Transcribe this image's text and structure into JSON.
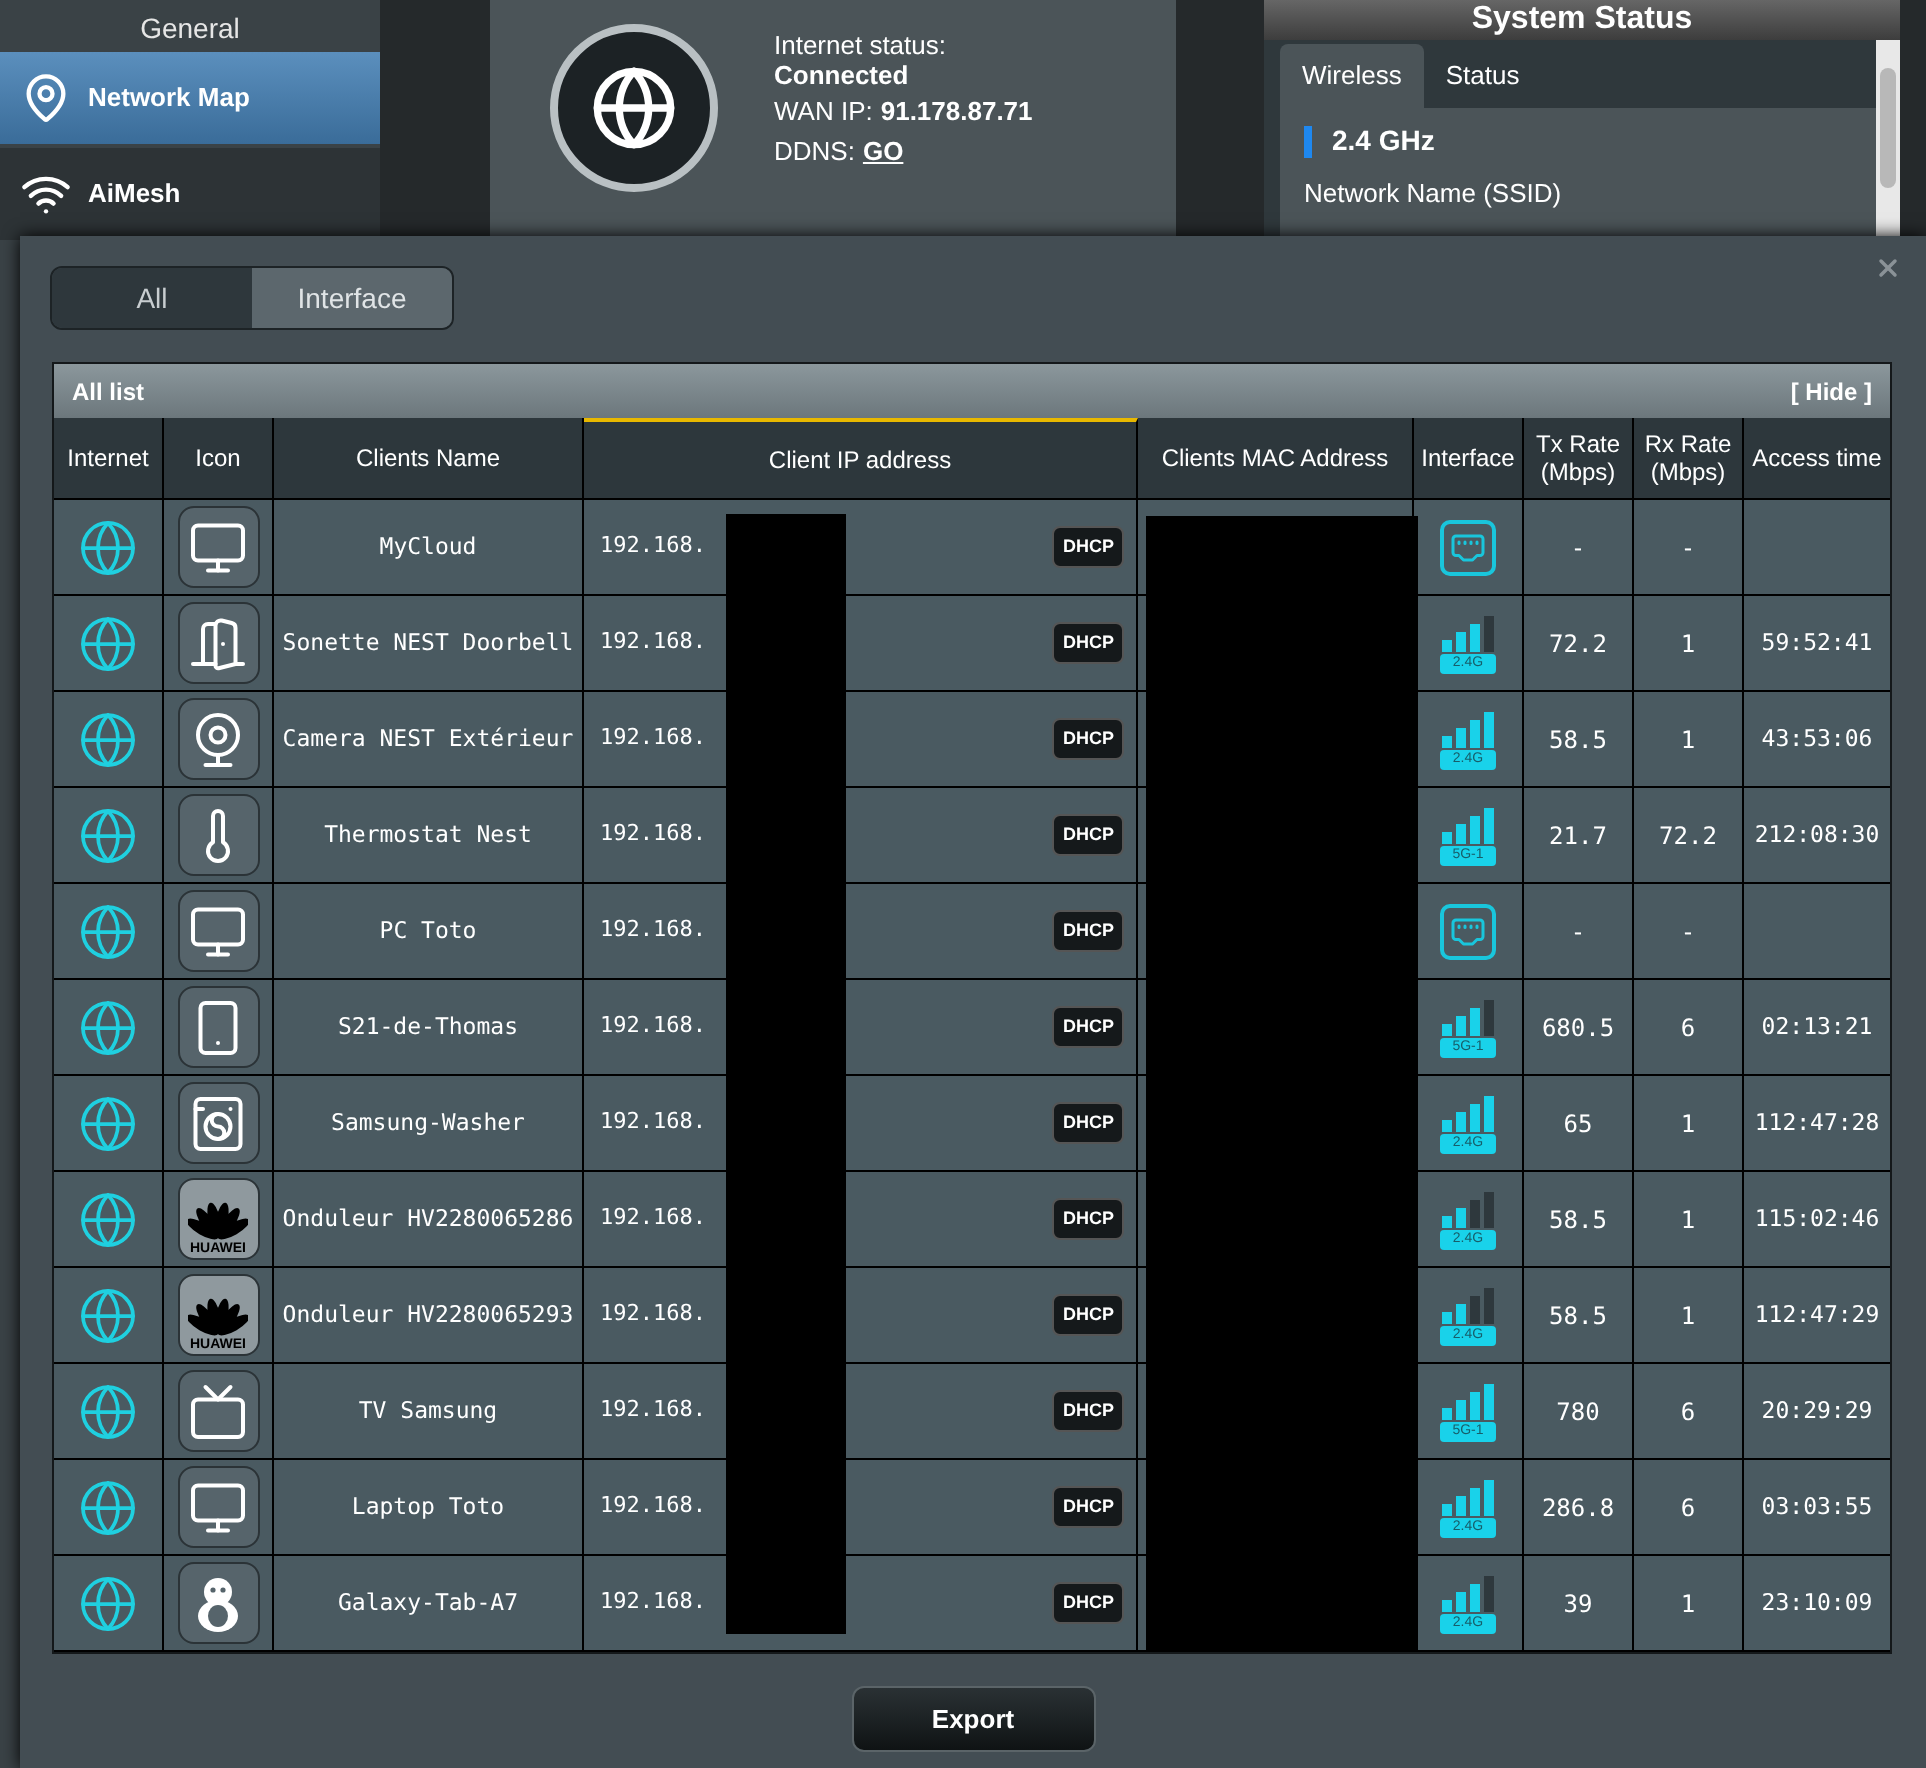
{
  "sidebar": {
    "header": "General",
    "items": [
      {
        "label": "Network Map",
        "kind": "map",
        "selected": true
      },
      {
        "label": "AiMesh",
        "kind": "mesh",
        "selected": false
      }
    ]
  },
  "internet": {
    "status_label": "Internet status:",
    "status": "Connected",
    "wan_ip_label": "WAN IP:",
    "wan_ip": "91.178.87.71",
    "ddns_label": "DDNS:",
    "ddns_link": "GO"
  },
  "system_status": {
    "title": "System Status",
    "tabs": [
      {
        "label": "Wireless",
        "selected": true
      },
      {
        "label": "Status",
        "selected": false
      }
    ],
    "band": "2.4 GHz",
    "field_label": "Network Name (SSID)"
  },
  "dialog": {
    "tabs": [
      {
        "label": "All",
        "selected": true
      },
      {
        "label": "Interface",
        "selected": false
      }
    ],
    "table": {
      "title": "All list",
      "hide_link": "[ Hide ]",
      "columns": [
        "Internet",
        "Icon",
        "Clients Name",
        "Client IP address",
        "Clients MAC Address",
        "Interface",
        "Tx Rate (Mbps)",
        "Rx Rate (Mbps)",
        "Access time"
      ],
      "rows": [
        {
          "name": "MyCloud",
          "kind": "monitor",
          "ip": "192.168.",
          "address_type": "DHCP",
          "interface": {
            "kind": "wired"
          },
          "tx": "-",
          "rx": "-"
        },
        {
          "name": "Sonette NEST Doorbell",
          "kind": "door",
          "ip": "192.168.",
          "address_type": "DHCP",
          "interface": {
            "kind": "wireless",
            "band": "2.4G",
            "level": 0.75
          },
          "tx": "72.2",
          "rx": "1",
          "access_time": "59:52:41"
        },
        {
          "name": "Camera NEST Extérieur",
          "kind": "camera",
          "ip": "192.168.",
          "address_type": "DHCP",
          "interface": {
            "kind": "wireless",
            "band": "2.4G",
            "level": 1
          },
          "tx": "58.5",
          "rx": "1",
          "access_time": "43:53:06"
        },
        {
          "name": "Thermostat Nest",
          "kind": "thermostat",
          "ip": "192.168.",
          "address_type": "DHCP",
          "interface": {
            "kind": "wireless",
            "band": "5G-1",
            "level": 1
          },
          "tx": "21.7",
          "rx": "72.2",
          "access_time": "212:08:30"
        },
        {
          "name": "PC Toto",
          "kind": "monitor",
          "ip": "192.168.",
          "address_type": "DHCP",
          "interface": {
            "kind": "wired"
          },
          "tx": "-",
          "rx": "-"
        },
        {
          "name": "S21-de-Thomas",
          "kind": "phone",
          "ip": "192.168.",
          "address_type": "DHCP",
          "interface": {
            "kind": "wireless",
            "band": "5G-1",
            "level": 0.75
          },
          "tx": "680.5",
          "rx": "6",
          "access_time": "02:13:21"
        },
        {
          "name": "Samsung-Washer",
          "kind": "appliance",
          "ip": "192.168.",
          "address_type": "DHCP",
          "interface": {
            "kind": "wireless",
            "band": "2.4G",
            "level": 1
          },
          "tx": "65",
          "rx": "1",
          "access_time": "112:47:28"
        },
        {
          "name": "Onduleur HV2280065286",
          "kind": "logo",
          "logo_text": "HUAWEI",
          "ip": "192.168.",
          "address_type": "DHCP",
          "interface": {
            "kind": "wireless",
            "band": "2.4G",
            "level": 0.5
          },
          "tx": "58.5",
          "rx": "1",
          "access_time": "115:02:46"
        },
        {
          "name": "Onduleur HV2280065293",
          "kind": "logo",
          "logo_text": "HUAWEI",
          "ip": "192.168.",
          "address_type": "DHCP",
          "interface": {
            "kind": "wireless",
            "band": "2.4G",
            "level": 0.5
          },
          "tx": "58.5",
          "rx": "1",
          "access_time": "112:47:29"
        },
        {
          "name": "TV Samsung",
          "kind": "tv",
          "ip": "192.168.",
          "address_type": "DHCP",
          "interface": {
            "kind": "wireless",
            "band": "5G-1",
            "level": 1
          },
          "tx": "780",
          "rx": "6",
          "access_time": "20:29:29"
        },
        {
          "name": "Laptop Toto",
          "kind": "monitor",
          "ip": "192.168.",
          "address_type": "DHCP",
          "interface": {
            "kind": "wireless",
            "band": "2.4G",
            "level": 1
          },
          "tx": "286.8",
          "rx": "6",
          "access_time": "03:03:55"
        },
        {
          "name": "Galaxy-Tab-A7",
          "kind": "penguin",
          "ip": "192.168.",
          "address_type": "DHCP",
          "interface": {
            "kind": "wireless",
            "band": "2.4G",
            "level": 0.75
          },
          "tx": "39",
          "rx": "1",
          "access_time": "23:10:09"
        }
      ]
    },
    "export_button": "Export"
  }
}
